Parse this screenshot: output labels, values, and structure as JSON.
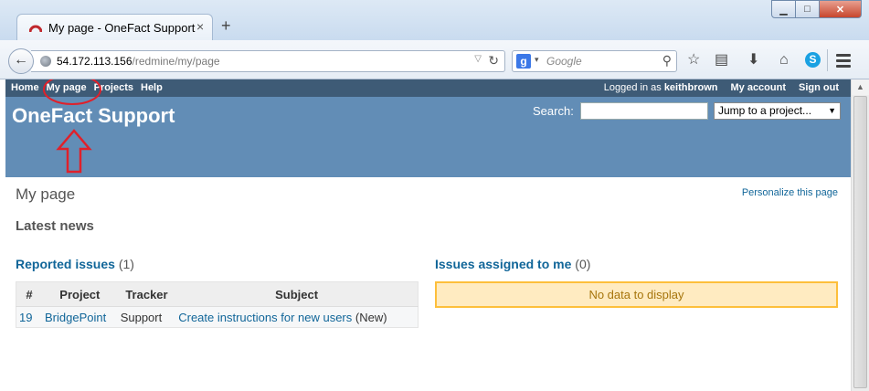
{
  "browser": {
    "tab_title": "My page - OneFact Support",
    "new_tab_glyph": "+",
    "url_host": "54.172.113.156",
    "url_path": "/redmine/my/page",
    "search_engine_letter": "g",
    "search_placeholder": "Google",
    "window_buttons": {
      "minimize": "▁",
      "maximize": "□",
      "close": "✕"
    },
    "icons": [
      "back-arrow-icon",
      "globe-icon",
      "reload-icon",
      "search-icon",
      "bookmark-star-icon",
      "reading-list-icon",
      "download-icon",
      "home-icon",
      "skype-icon",
      "menu-icon"
    ]
  },
  "top_menu": {
    "items": [
      "Home",
      "My page",
      "Projects",
      "Help"
    ],
    "logged_in_prefix": "Logged in as",
    "username": "keithbrown",
    "my_account": "My account",
    "sign_out": "Sign out"
  },
  "header": {
    "site_title": "OneFact Support",
    "search_label": "Search:",
    "search_value": "",
    "jump_label": "Jump to a project..."
  },
  "annotation": {
    "color": "#e0202a",
    "target": "My page"
  },
  "content": {
    "page_title": "My page",
    "personalize": "Personalize this page",
    "latest_news": "Latest news",
    "reported": {
      "title": "Reported issues",
      "count": "(1)",
      "columns": [
        "#",
        "Project",
        "Tracker",
        "Subject"
      ],
      "rows": [
        {
          "id": "19",
          "project": "BridgePoint",
          "tracker": "Support",
          "subject": "Create instructions for new users",
          "status": "(New)"
        }
      ]
    },
    "assigned": {
      "title": "Issues assigned to me",
      "count": "(0)",
      "no_data": "No data to display"
    }
  },
  "colors": {
    "top_menu_bg": "#3e5b76",
    "header_bg": "#628db6",
    "link": "#116699",
    "nodata_bg": "#ffebc1",
    "nodata_border": "#fdbf3b"
  }
}
